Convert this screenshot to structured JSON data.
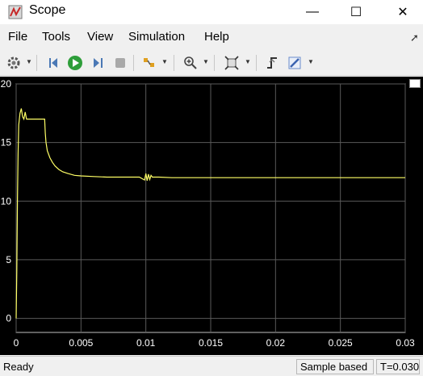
{
  "window": {
    "title": "Scope",
    "controls": {
      "minimize": "—",
      "maximize": "☐",
      "close": "✕"
    }
  },
  "menu": {
    "items": [
      "File",
      "Tools",
      "View",
      "Simulation",
      "Help"
    ]
  },
  "toolbar": {
    "icons": [
      "gear-icon",
      "step-back-icon",
      "run-icon",
      "step-forward-icon",
      "stop-icon",
      "highlight-icon",
      "zoom-in-icon",
      "autoscale-icon",
      "triggers-icon",
      "style-icon"
    ]
  },
  "colors": {
    "plot_background": "#000000",
    "signal": "#ffff66",
    "grid": "#5a5a5a",
    "tick_text": "#ffffff"
  },
  "chart_data": {
    "type": "line",
    "title": "",
    "xlabel": "",
    "ylabel": "",
    "xlim": [
      0,
      0.03
    ],
    "ylim": [
      -1.2,
      20
    ],
    "x_ticks": [
      "0",
      "0.005",
      "0.01",
      "0.015",
      "0.02",
      "0.025",
      "0.03"
    ],
    "y_ticks": [
      "0",
      "5",
      "10",
      "15",
      "20"
    ],
    "grid": true,
    "series": [
      {
        "x": [
          0,
          5e-05,
          0.0001,
          0.00015,
          0.0002,
          0.0003,
          0.0004,
          0.0005,
          0.0006,
          0.0007,
          0.0008,
          0.0012,
          0.0016,
          0.002,
          0.0022,
          0.00225,
          0.0023,
          0.0024,
          0.0026,
          0.0028,
          0.003,
          0.0033,
          0.0036,
          0.004,
          0.0045,
          0.005,
          0.006,
          0.007,
          0.008,
          0.0095,
          0.0099,
          0.01,
          0.0101,
          0.0102,
          0.0103,
          0.0104,
          0.0105,
          0.011,
          0.012,
          0.015,
          0.02,
          0.025,
          0.03
        ],
        "y": [
          0,
          4,
          10,
          14,
          16.5,
          17.5,
          17.9,
          17.2,
          17.0,
          17.6,
          17.0,
          17.0,
          17.0,
          17.0,
          17.0,
          15.8,
          15.0,
          14.3,
          13.7,
          13.3,
          13.0,
          12.7,
          12.5,
          12.35,
          12.2,
          12.15,
          12.1,
          12.05,
          12.05,
          12.05,
          11.8,
          12.35,
          11.75,
          12.3,
          11.85,
          12.2,
          12.05,
          12.05,
          12.0,
          12.0,
          12.0,
          12.0,
          12.0
        ]
      }
    ]
  },
  "status": {
    "ready": "Ready",
    "sample_mode": "Sample based",
    "time": "T=0.030"
  }
}
